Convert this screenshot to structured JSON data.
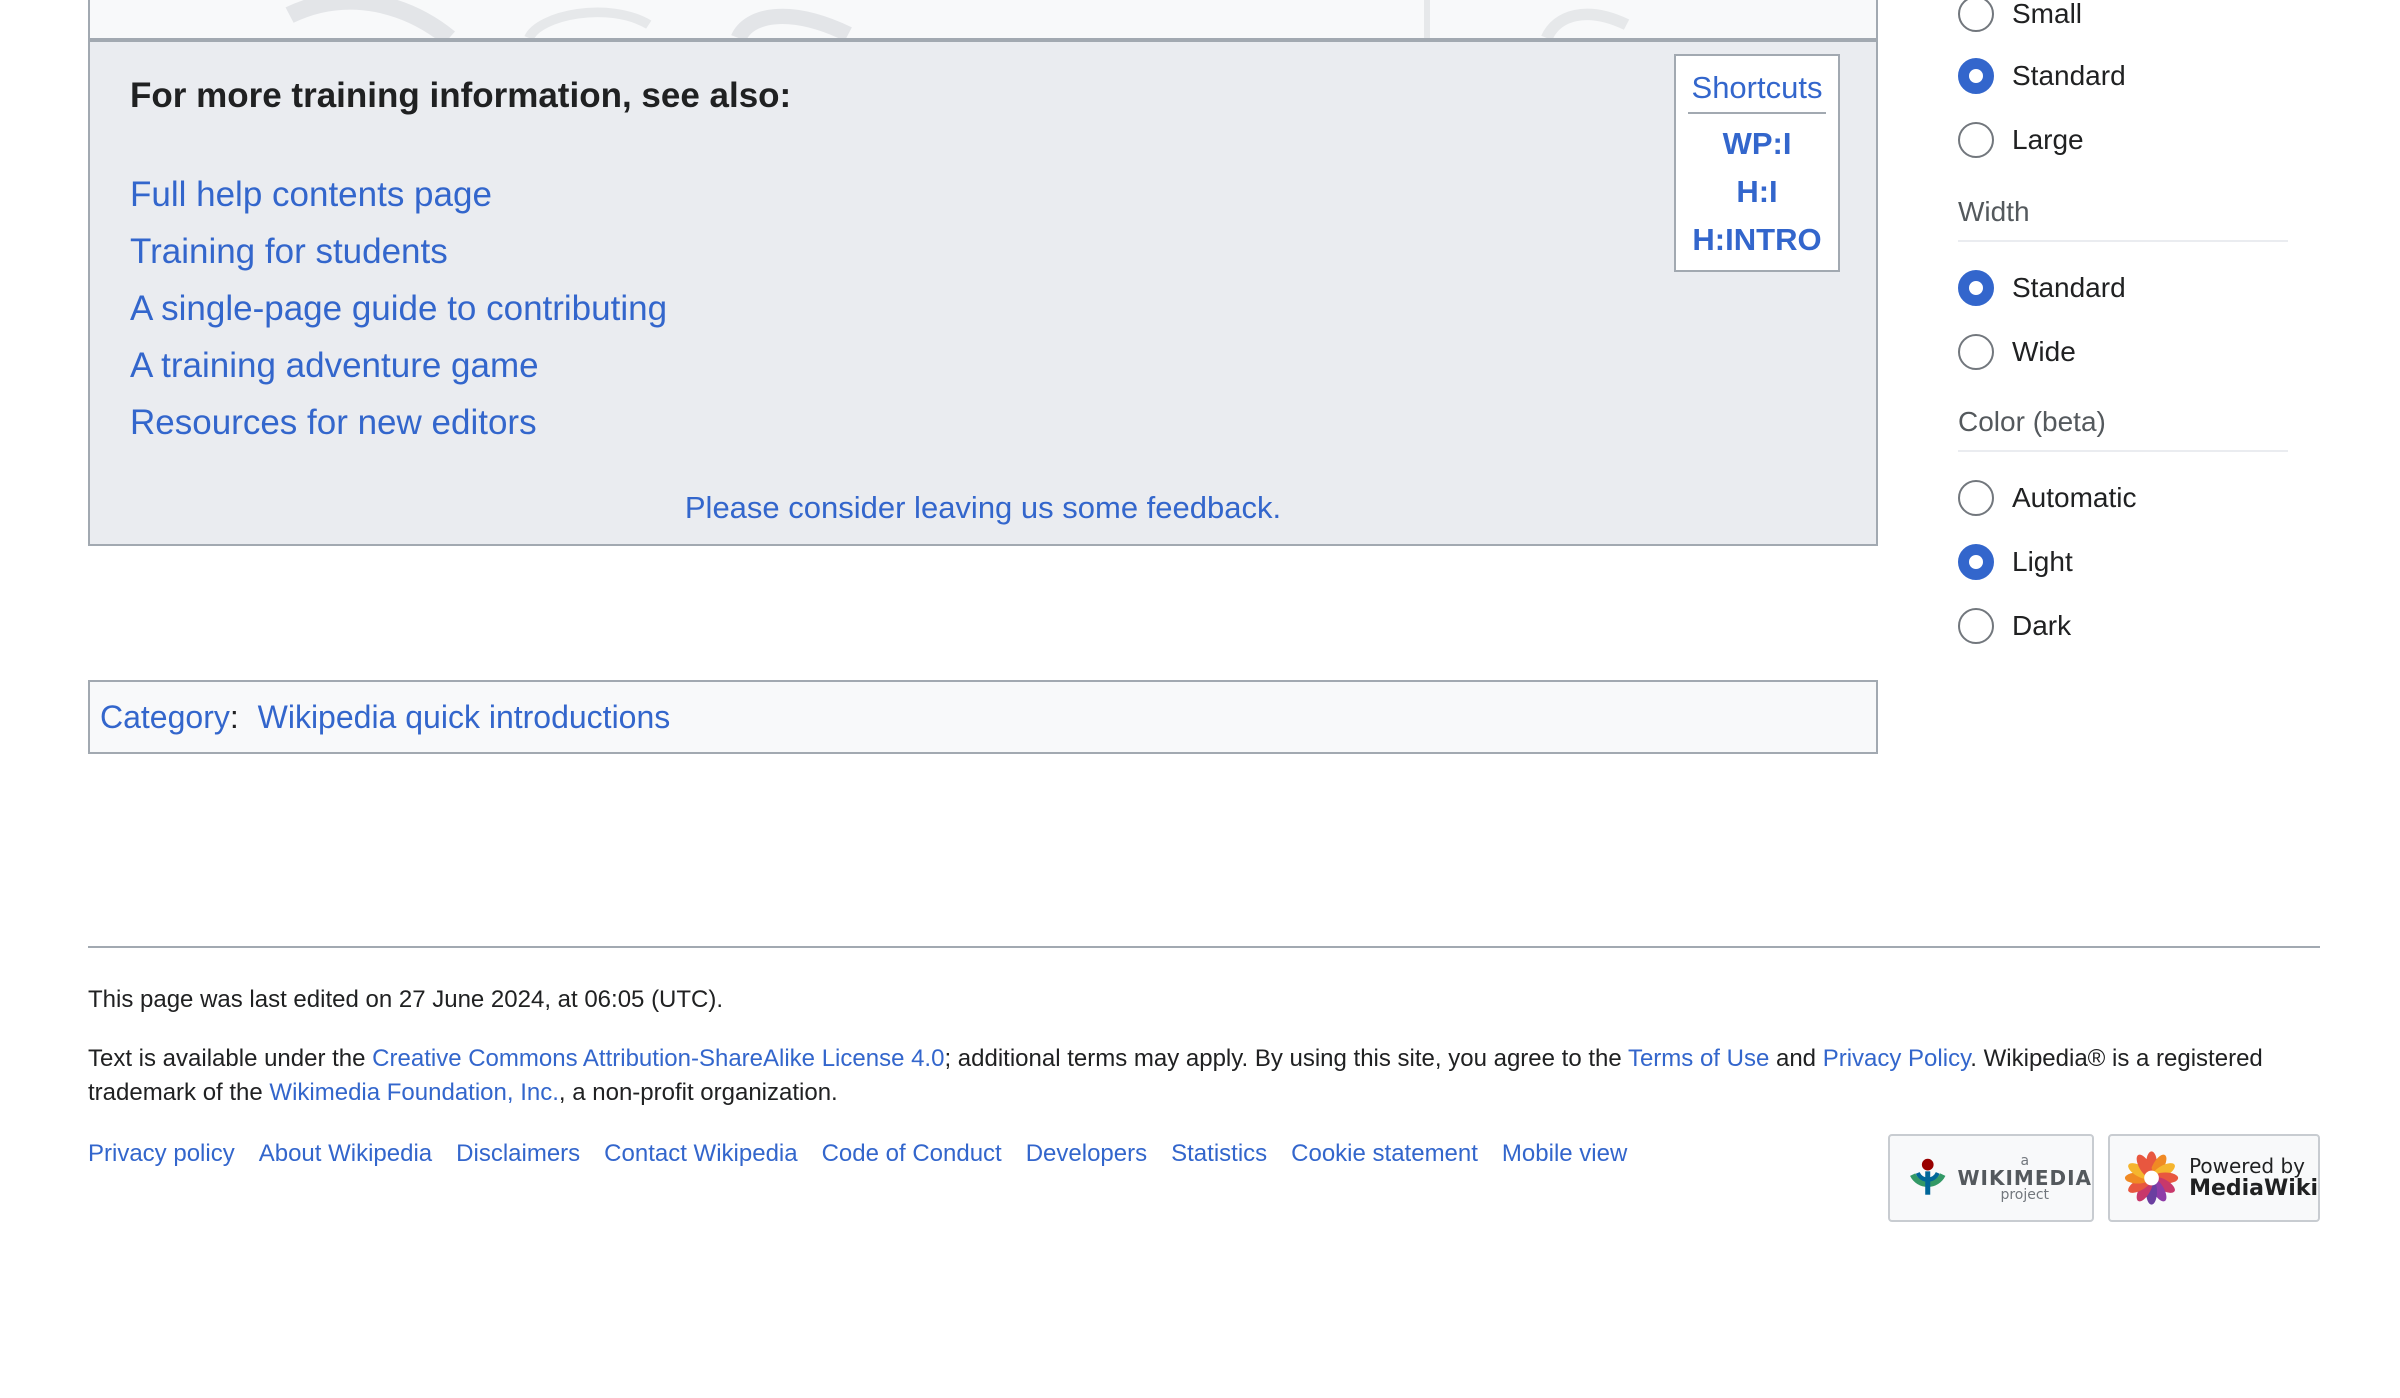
{
  "see_also": {
    "title": "For more training information, see also:",
    "links": [
      "Full help contents page",
      "Training for students",
      "A single-page guide to contributing",
      "A training adventure game",
      "Resources for new editors"
    ],
    "feedback": "Please consider leaving us some feedback."
  },
  "shortcuts": {
    "title": "Shortcuts",
    "items": [
      "WP:I",
      "H:I",
      "H:INTRO"
    ]
  },
  "category": {
    "label": "Category",
    "separator": ":",
    "link": "Wikipedia quick introductions"
  },
  "appearance": {
    "text_options": [
      "Small",
      "Standard",
      "Large"
    ],
    "text_selected": "Standard",
    "width_label": "Width",
    "width_options": [
      "Standard",
      "Wide"
    ],
    "width_selected": "Standard",
    "color_label": "Color (beta)",
    "color_options": [
      "Automatic",
      "Light",
      "Dark"
    ],
    "color_selected": "Light",
    "accent_color": "#3366cc"
  },
  "footer": {
    "last_modified": "This page was last edited on 27 June 2024, at 06:05 (UTC).",
    "license": {
      "part1": "Text is available under the ",
      "cc_link": "Creative Commons Attribution-ShareAlike License 4.0",
      "part2": "; additional terms may apply. By using this site, you agree to the ",
      "terms_link": "Terms of Use",
      "part3": " and ",
      "privacy_link": "Privacy Policy",
      "part4": ". Wikipedia® is a registered trademark of the ",
      "foundation_link": "Wikimedia Foundation, Inc.",
      "part5": ", a non-profit organization."
    },
    "places": [
      "Privacy policy",
      "About Wikipedia",
      "Disclaimers",
      "Contact Wikipedia",
      "Code of Conduct",
      "Developers",
      "Statistics",
      "Cookie statement",
      "Mobile view"
    ],
    "wikimedia_badge": {
      "top": "a",
      "main": "WIKIMEDIA",
      "bottom": "project"
    },
    "mediawiki_badge": {
      "top": "Powered by",
      "main": "MediaWiki"
    }
  }
}
